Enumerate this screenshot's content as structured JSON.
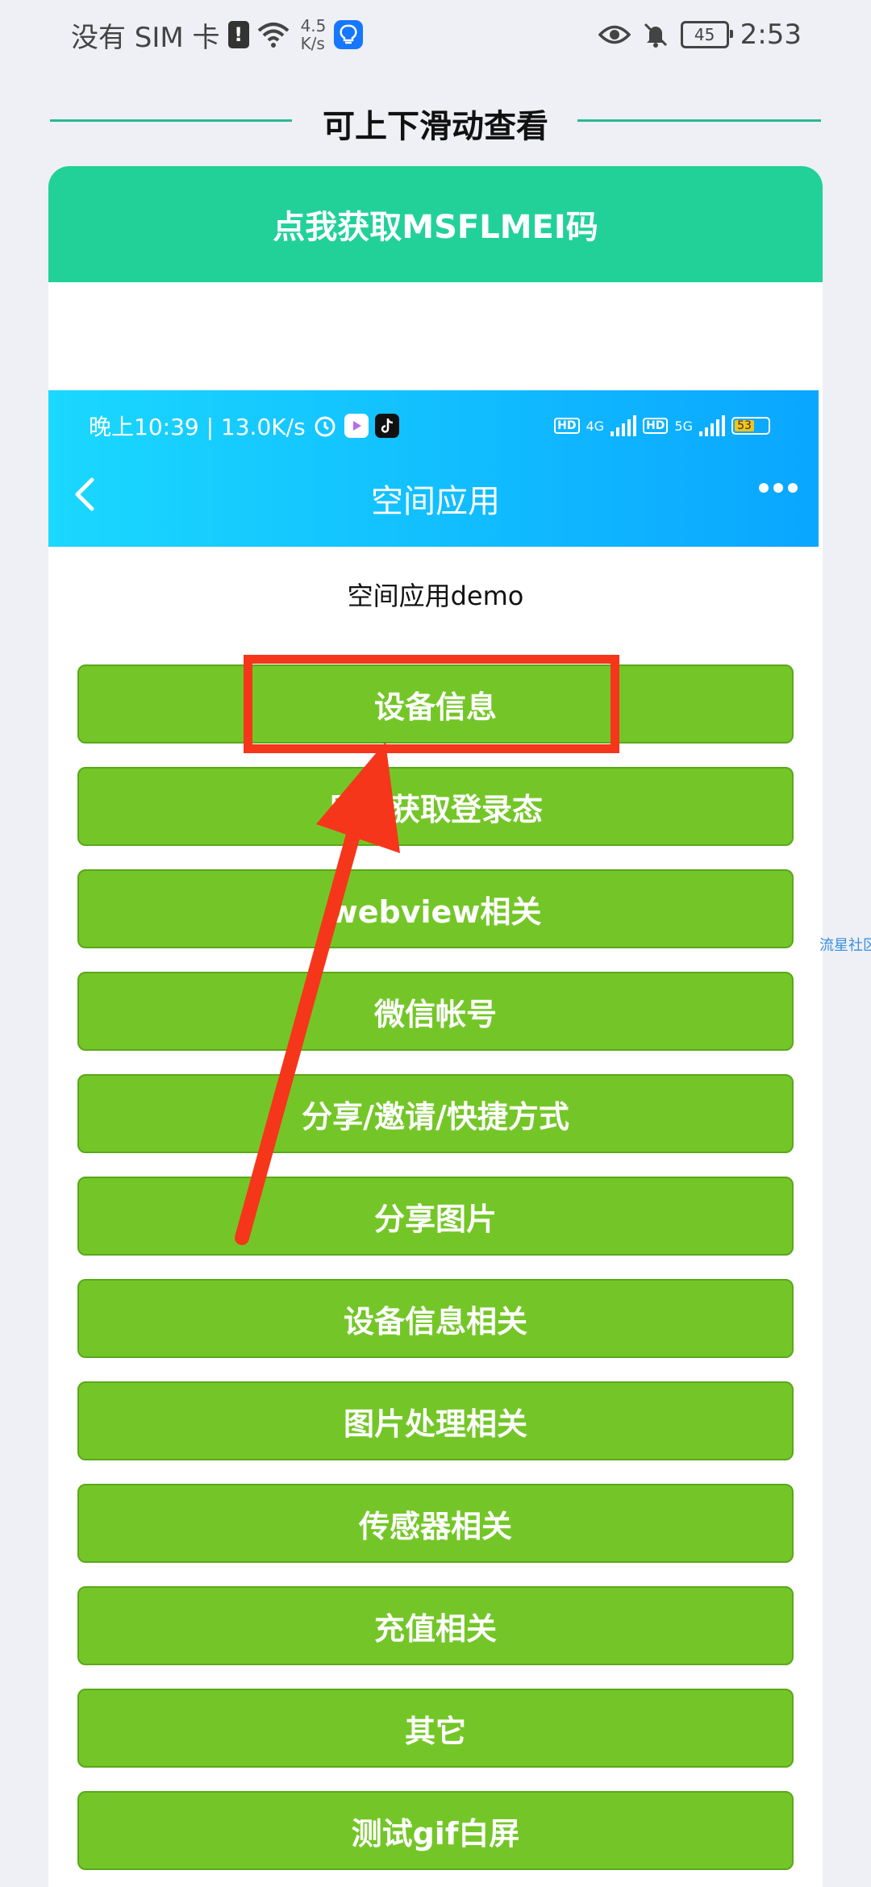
{
  "status_bar": {
    "carrier": "没有 SIM 卡",
    "alert_glyph": "!",
    "speed_value": "4.5",
    "speed_unit": "K/s",
    "battery": "45",
    "time": "2:53"
  },
  "header": {
    "title": "可上下滑动查看"
  },
  "get_code_button": {
    "label": "点我获取MSFLMEI码"
  },
  "inner_screenshot": {
    "status_bar": {
      "time_speed": "晚上10:39 | 13.0K/s",
      "hd1": "HD",
      "net1": "4G",
      "hd2": "HD",
      "net2": "5G",
      "battery": "53"
    },
    "nav_title": "空间应用",
    "demo_title": "空间应用demo",
    "buttons": [
      "设备信息",
      "异步获取登录态",
      "webview相关",
      "微信帐号",
      "分享/邀请/快捷方式",
      "分享图片",
      "设备信息相关",
      "图片处理相关",
      "传感器相关",
      "充值相关",
      "其它",
      "测试gif白屏"
    ]
  },
  "side_link": "流星社区",
  "colors": {
    "accent_green": "#22d198",
    "button_green": "#74c628",
    "highlight_red": "#f5361a",
    "inner_header_blue": "#0aa6ff"
  }
}
